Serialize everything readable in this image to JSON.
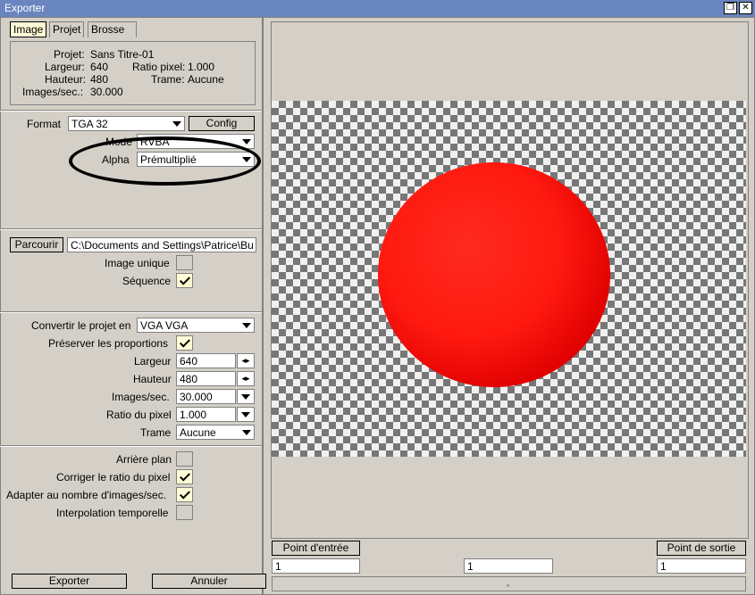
{
  "window": {
    "title": "Exporter"
  },
  "tabs": [
    "Image",
    "Projet",
    "Brosse"
  ],
  "info": {
    "projet_label": "Projet:",
    "projet_value": "Sans Titre-01",
    "largeur_label": "Largeur:",
    "largeur_value": "640",
    "ratio_label": "Ratio pixel:",
    "ratio_value": "1.000",
    "hauteur_label": "Hauteur:",
    "hauteur_value": "480",
    "trame_label": "Trame:",
    "trame_value": "Aucune",
    "fps_label": "Images/sec.:",
    "fps_value": "30.000"
  },
  "format": {
    "label": "Format",
    "value": "TGA 32",
    "config_label": "Config"
  },
  "mode": {
    "label": "Mode",
    "value": "RVBA"
  },
  "alpha": {
    "label": "Alpha",
    "value": "Prémultiplié"
  },
  "path": {
    "browse_label": "Parcourir",
    "value": "C:\\Documents and Settings\\Patrice\\Bu"
  },
  "image_unique": {
    "label": "Image unique",
    "checked": false
  },
  "sequence": {
    "label": "Séquence",
    "checked": true
  },
  "convert": {
    "label": "Convertir le projet en",
    "value": "VGA VGA"
  },
  "preserve": {
    "label": "Préserver les proportions",
    "checked": true
  },
  "largeur": {
    "label": "Largeur",
    "value": "640"
  },
  "hauteur": {
    "label": "Hauteur",
    "value": "480"
  },
  "images_sec": {
    "label": "Images/sec.",
    "value": "30.000"
  },
  "ratio_pixel": {
    "label": "Ratio du pixel",
    "value": "1.000"
  },
  "trame": {
    "label": "Trame",
    "value": "Aucune"
  },
  "arriere_plan": {
    "label": "Arrière plan",
    "checked": false
  },
  "corriger": {
    "label": "Corriger le ratio du pixel",
    "checked": true
  },
  "adapter": {
    "label": "Adapter au nombre d'images/sec.",
    "checked": true
  },
  "interpolation": {
    "label": "Interpolation temporelle",
    "checked": false
  },
  "buttons": {
    "exporter": "Exporter",
    "annuler": "Annuler"
  },
  "timeline": {
    "in_label": "Point d'entrée",
    "out_label": "Point de sortie",
    "in_value": "1",
    "current_value": "1",
    "out_value": "1"
  },
  "colors": {
    "titlebar": "#6a86bf",
    "sphere": "#ff1a10",
    "check_bg": "#fffbd6"
  }
}
